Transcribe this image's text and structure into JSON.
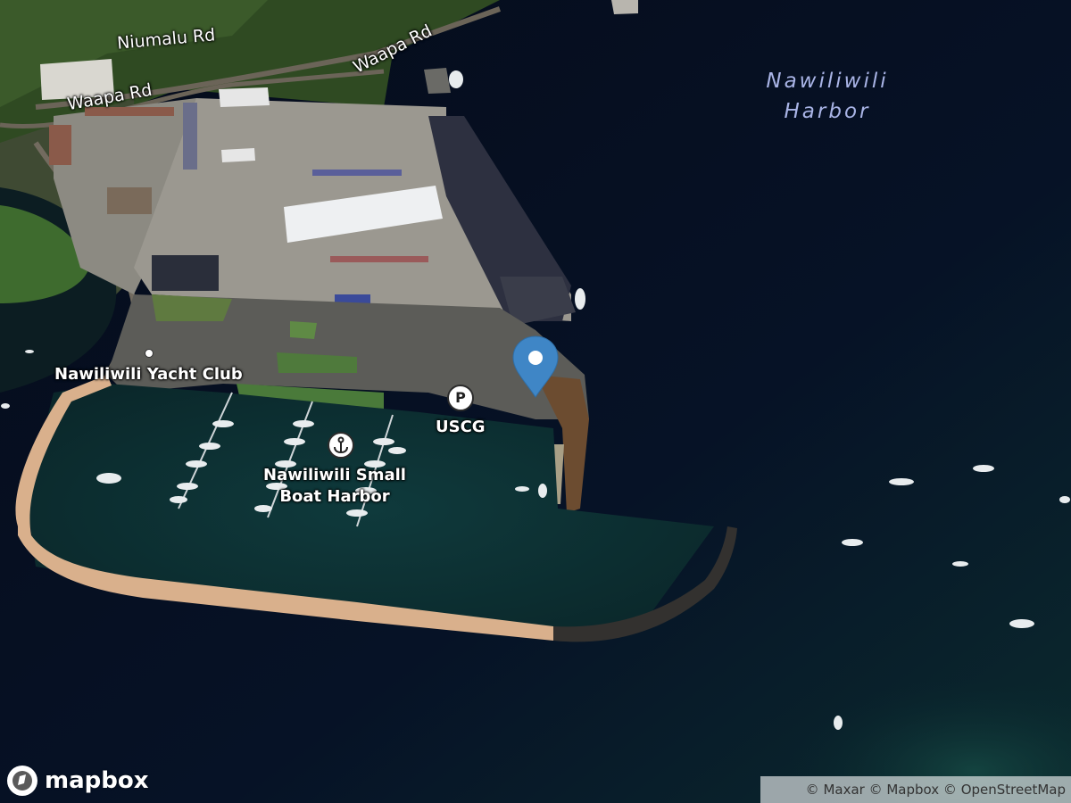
{
  "water_label": {
    "line1": "Nawiliwili",
    "line2": "Harbor"
  },
  "roads": [
    {
      "name": "Niumalu Rd"
    },
    {
      "name": "Waapa Rd"
    },
    {
      "name": "Waapa Rd"
    }
  ],
  "places": {
    "yacht_club": "Nawiliwili Yacht Club",
    "small_boat_harbor_line1": "Nawiliwili Small",
    "small_boat_harbor_line2": "Boat Harbor",
    "uscg": "USCG"
  },
  "icons": {
    "parking": "P",
    "parking_name": "parking-icon",
    "harbor_name": "anchor-icon",
    "marker_name": "location-pin-icon"
  },
  "marker": {
    "color": "#3f86c6"
  },
  "logo": {
    "text": "mapbox"
  },
  "attribution": {
    "maxar": "© Maxar",
    "mapbox": "© Mapbox",
    "osm": "© OpenStreetMap"
  }
}
